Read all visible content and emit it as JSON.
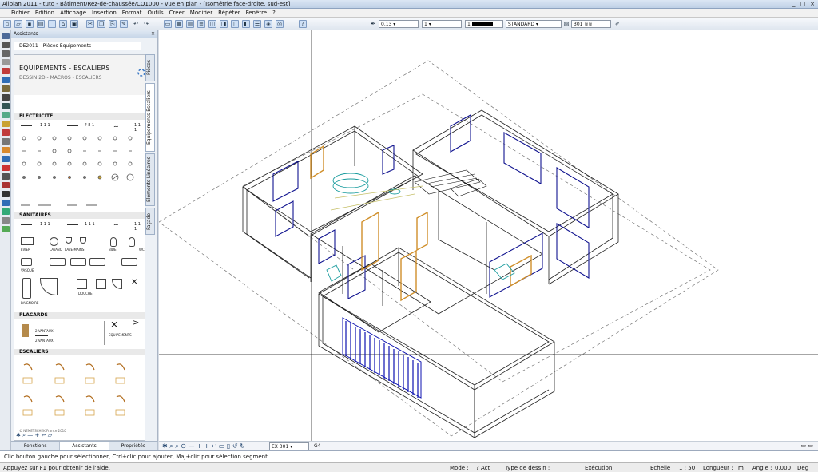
{
  "window": {
    "title": "Allplan 2011 - tuto - Bâtiment/Rez-de-chaussée/CQ1000 - vue en plan - [Isométrie face-droite, sud-est]",
    "controls": [
      "_",
      "□",
      "×"
    ]
  },
  "menu": [
    "Fichier",
    "Edition",
    "Affichage",
    "Insertion",
    "Format",
    "Outils",
    "Créer",
    "Modifier",
    "Répéter",
    "Fenêtre",
    "?"
  ],
  "toolbar": {
    "pen_thickness": "0.13",
    "line_type": "1",
    "color_value": "1",
    "style": "STANDARD",
    "hatch_no": "301"
  },
  "panel": {
    "title": "Assistants",
    "dropdown": "DE2011 - Pièces-Equipements",
    "palette_title": "EQUIPEMENTS - ESCALIERS",
    "palette_subtitle": "DESSIN 2D - MACROS - ESCALIERS",
    "sections": [
      {
        "key": "elec",
        "label": "ELECTRICITE"
      },
      {
        "key": "sani",
        "label": "SANITAIRES"
      },
      {
        "key": "plac",
        "label": "PLACARDS"
      },
      {
        "key": "esca",
        "label": "ESCALIERS"
      }
    ],
    "vertical_tabs": [
      "Pièces",
      "Equipements Escaliers",
      "Eléments Linéaires",
      "Façade"
    ],
    "copyright": "© NEMETSCHEK France 2010",
    "bottom_tabs": [
      "Fonctions",
      "Assistants",
      "Propriétés"
    ],
    "small_labels": {
      "evier": "EVIER",
      "lavabo": "LAVABO",
      "lave_mains": "LAVE-MAINS",
      "bidet": "BIDET",
      "wc": "WC",
      "vasque": "VASQUE",
      "baignoire": "BAIGNOIRE",
      "douche": "DOUCHE",
      "equipements": "EQUIPEMENTS",
      "portes": "2 VANTAUX",
      "ligne_1": "1 1 1",
      "ligne_2": "? 8 1",
      "ligne_3": "1 1 1"
    }
  },
  "viewport": {
    "zoom_field": "EX 301",
    "zoom_extra": "G4"
  },
  "command_line": "Clic bouton gauche pour sélectionner, Ctrl+clic pour ajouter, Maj+clic pour sélection segment",
  "status": {
    "help": "Appuyez sur F1 pour obtenir de l'aide.",
    "mode_label": "Mode :",
    "mode_value": "? Act",
    "type_label": "Type de dessin :",
    "type_value": "Exécution",
    "scale_label": "Echelle :",
    "scale_value": "1 : 50",
    "length_label": "Longueur :",
    "length_value": "m",
    "angle_label": "Angle :",
    "angle_value": "0.000",
    "angle_unit": "Deg"
  },
  "colors": {
    "wall": "#222222",
    "window_blue": "#10138f",
    "door_orange": "#d08f2a",
    "teal": "#1a9c9e",
    "garage_blue": "#0c12b0"
  }
}
